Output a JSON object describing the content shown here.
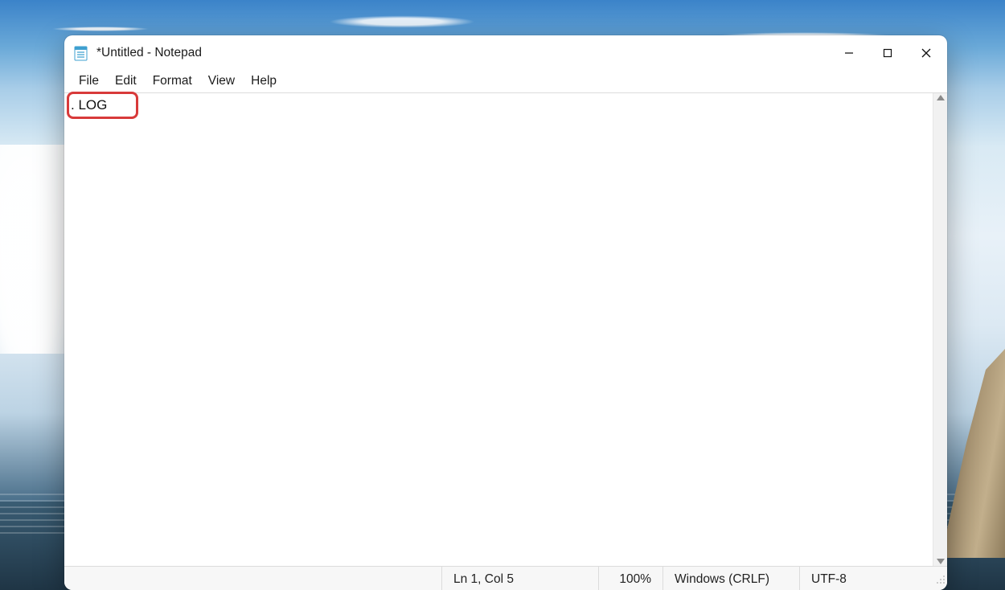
{
  "titlebar": {
    "title": "*Untitled - Notepad"
  },
  "menubar": {
    "items": [
      "File",
      "Edit",
      "Format",
      "View",
      "Help"
    ]
  },
  "editor": {
    "content": ". LOG"
  },
  "statusbar": {
    "position": "Ln 1, Col 5",
    "zoom": "100%",
    "line_ending": "Windows (CRLF)",
    "encoding": "UTF-8"
  }
}
